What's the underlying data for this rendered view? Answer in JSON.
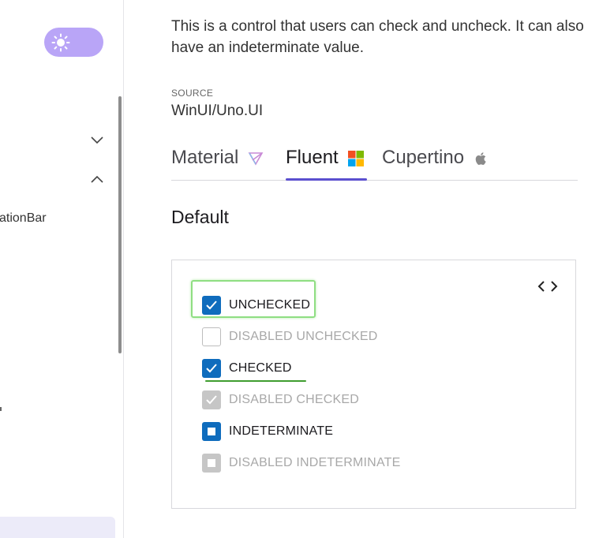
{
  "sidebar": {
    "theme_toggle_icon": "sun-icon",
    "nav_partial_label": "ationBar",
    "expand_icon": "chevron-down-icon",
    "collapse_icon": "chevron-up-icon"
  },
  "page": {
    "description": "This is a control that users can check and uncheck. It can also have an indeterminate value.",
    "source_label": "SOURCE",
    "source_value": "WinUI/Uno.UI"
  },
  "tabs": [
    {
      "label": "Material",
      "icon": "material-icon",
      "selected": false
    },
    {
      "label": "Fluent",
      "icon": "windows-icon",
      "selected": true
    },
    {
      "label": "Cupertino",
      "icon": "apple-icon",
      "selected": false
    }
  ],
  "section": {
    "title": "Default"
  },
  "checkboxes": [
    {
      "label": "UNCHECKED",
      "state": "checked",
      "disabled": false
    },
    {
      "label": "DISABLED UNCHECKED",
      "state": "unchecked",
      "disabled": true
    },
    {
      "label": "CHECKED",
      "state": "checked",
      "disabled": false
    },
    {
      "label": "DISABLED CHECKED",
      "state": "checked",
      "disabled": true
    },
    {
      "label": "INDETERMINATE",
      "state": "indeterminate",
      "disabled": false
    },
    {
      "label": "DISABLED INDETERMINATE",
      "state": "indeterminate",
      "disabled": true
    }
  ],
  "colors": {
    "accent": "#0f6cbd",
    "tab_indicator": "#5b4fcf",
    "toggle_bg": "#b9a5f7",
    "annotation_green": "#8fde82"
  }
}
